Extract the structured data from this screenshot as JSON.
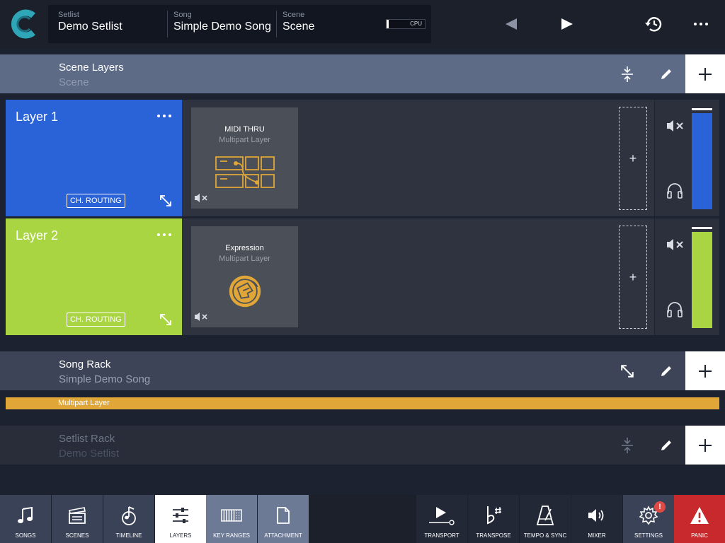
{
  "header": {
    "setlist_label": "Setlist",
    "setlist_value": "Demo Setlist",
    "song_label": "Song",
    "song_value": "Simple Demo Song",
    "scene_label": "Scene",
    "scene_value": "Scene",
    "cpu_label": "CPU"
  },
  "scene_layers": {
    "title": "Scene Layers",
    "subtitle": "Scene"
  },
  "layers": [
    {
      "name": "Layer 1",
      "color": "#2a62d8",
      "routing_label": "CH. ROUTING",
      "plugin_name": "MIDI THRU",
      "plugin_type": "Multipart Layer",
      "add_label": "+",
      "meter_level": 0.97
    },
    {
      "name": "Layer 2",
      "color": "#a9d542",
      "routing_label": "CH. ROUTING",
      "plugin_name": "Expression",
      "plugin_type": "Multipart Layer",
      "add_label": "+",
      "meter_level": 0.97
    }
  ],
  "song_rack": {
    "title": "Song Rack",
    "subtitle": "Simple Demo Song",
    "multipart_label": "Multipart Layer"
  },
  "setlist_rack": {
    "title": "Setlist Rack",
    "subtitle": "Demo Setlist"
  },
  "tabs_left": [
    {
      "label": "SONGS",
      "icon": "music-note-icon"
    },
    {
      "label": "SCENES",
      "icon": "clapperboard-icon"
    },
    {
      "label": "TIMELINE",
      "icon": "timeline-icon"
    },
    {
      "label": "LAYERS",
      "icon": "sliders-icon",
      "active": true
    },
    {
      "label": "KEY RANGES",
      "icon": "keyboard-icon"
    },
    {
      "label": "ATTACHMENT",
      "icon": "document-icon"
    }
  ],
  "tabs_right": [
    {
      "label": "TRANSPORT",
      "icon": "play-icon"
    },
    {
      "label": "TRANSPOSE",
      "icon": "flat-sharp-icon"
    },
    {
      "label": "TEMPO & SYNC",
      "icon": "metronome-icon"
    },
    {
      "label": "MIXER",
      "icon": "speaker-icon"
    },
    {
      "label": "SETTINGS",
      "icon": "gear-icon",
      "badge": "!"
    },
    {
      "label": "PANIC",
      "icon": "warning-icon"
    }
  ],
  "colors": {
    "accent_blue": "#2a62d8",
    "accent_green": "#a9d542",
    "plugin_orange": "#e0a637",
    "panic_red": "#c8292d"
  }
}
